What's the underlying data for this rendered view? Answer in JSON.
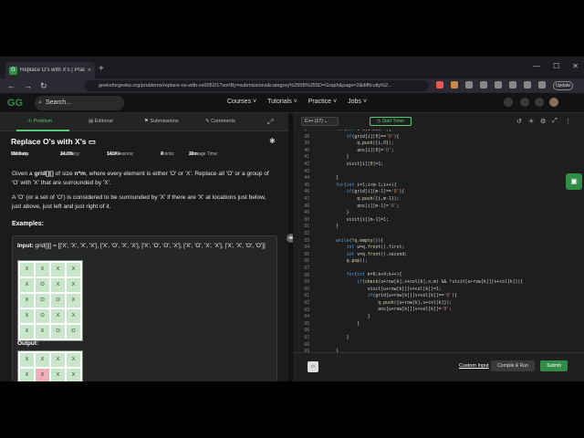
{
  "browser": {
    "tab_title": "Replace O's with X's | Practice | G",
    "new_tab": "+",
    "url": "geeksforgeeks.org/problems/replace-os-with-xs0052/1?sortBy=submissions&category%255B%255D=Graph&page=2&difficulty%2...",
    "update_label": "Update"
  },
  "site": {
    "logo": "GG",
    "search_placeholder": "Search...",
    "menu": [
      "Courses",
      "Tutorials",
      "Practice",
      "Jobs"
    ],
    "menu_arrow": "˅"
  },
  "panel_tabs": [
    "Problem",
    "Editorial",
    "Submissions",
    "Comments"
  ],
  "problem": {
    "title": "Replace O's with X's",
    "difficulty_label": "Difficulty:",
    "difficulty": "Medium",
    "accuracy_label": "Accuracy:",
    "accuracy": "34.0%",
    "submissions_label": "Submissions:",
    "submissions": "141K+",
    "points_label": "Points:",
    "points": "4",
    "time_label": "Average Time:",
    "time": "20m",
    "desc1a": "Given a ",
    "desc1b": "grid[][]",
    "desc1c": " of size ",
    "desc1d": "n*m",
    "desc1e": ", where every element is either 'O' or 'X'. Replace all 'O' or a group of 'O' with 'X' that are surrounded by 'X'.",
    "desc2": "A 'O' (or a set of 'O') is considered to be surrounded by 'X' if there are 'X' at locations just below, just above, just left and just right of it.",
    "examples_heading": "Examples:",
    "input_label": "Input:",
    "input_value": "grid[][] = [['X', 'X', 'X', 'X'], ['X', 'O', 'X', 'X'], ['X', 'O', 'O', 'X'], ['X', 'O', 'X', 'X'], ['X', 'X', 'O', 'O']]",
    "output_label": "Output:",
    "input_grid": [
      [
        "X",
        "X",
        "X",
        "X"
      ],
      [
        "X",
        "O",
        "X",
        "X"
      ],
      [
        "X",
        "O",
        "O",
        "X"
      ],
      [
        "X",
        "O",
        "X",
        "X"
      ],
      [
        "X",
        "X",
        "O",
        "O"
      ]
    ],
    "output_grid_rows": [
      [
        "X",
        "X",
        "X",
        "X"
      ],
      [
        "X",
        "X",
        "X",
        "X"
      ]
    ]
  },
  "editor": {
    "language": "C++ (17)",
    "timer_label": "Start Timer",
    "line_numbers": [
      "37",
      "38",
      "39",
      "40",
      "41",
      "42",
      "43",
      "44",
      "45",
      "46",
      "47",
      "48",
      "49",
      "50",
      "51",
      "52",
      "53",
      "54",
      "55",
      "56",
      "57",
      "58",
      "59",
      "60",
      "61",
      "62",
      "63",
      "64",
      "65",
      "66",
      "67",
      "68",
      "69",
      "70",
      "71"
    ],
    "custom_input": "Custom Input",
    "compile_run": "Compile & Run",
    "submit": "Submit"
  },
  "colors": {
    "accent": "#2f8d46",
    "accent_light": "#57c774"
  }
}
